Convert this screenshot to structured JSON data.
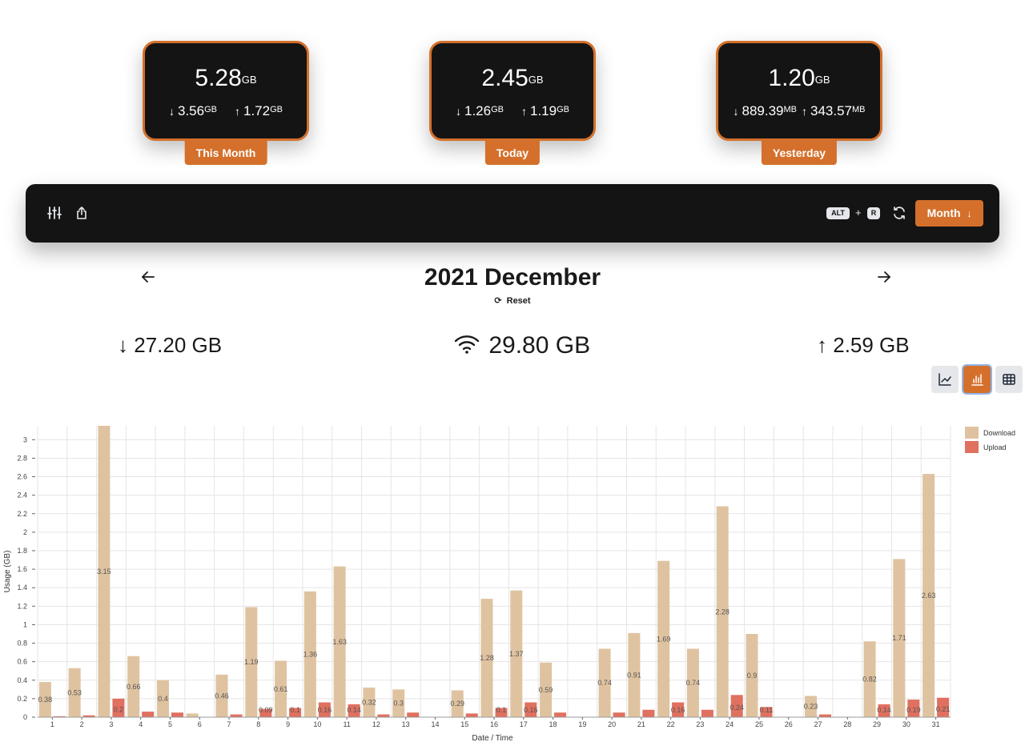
{
  "cards": [
    {
      "total": "5.28",
      "total_unit": "GB",
      "down": "3.56",
      "down_unit": "GB",
      "up": "1.72",
      "up_unit": "GB",
      "label": "This Month"
    },
    {
      "total": "2.45",
      "total_unit": "GB",
      "down": "1.26",
      "down_unit": "GB",
      "up": "1.19",
      "up_unit": "GB",
      "label": "Today"
    },
    {
      "total": "1.20",
      "total_unit": "GB",
      "down": "889.39",
      "down_unit": "MB",
      "up": "343.57",
      "up_unit": "MB",
      "label": "Yesterday"
    }
  ],
  "toolbar": {
    "filter_icon": "sliders-icon",
    "share_icon": "share-icon",
    "shortcut_key1": "ALT",
    "shortcut_plus": "+",
    "shortcut_key2": "R",
    "refresh_icon": "refresh-icon",
    "period_label": "Month"
  },
  "period": {
    "title": "2021 December",
    "reset_label": "Reset"
  },
  "totals": {
    "download": "27.20 GB",
    "total": "29.80 GB",
    "upload": "2.59 GB"
  },
  "view_modes": {
    "active": "bar",
    "options": [
      "line-chart-icon",
      "bar-chart-icon",
      "table-icon"
    ]
  },
  "colors": {
    "accent": "#d4702b",
    "download": "#dfc3a0",
    "upload": "#e0705f"
  },
  "chart_data": {
    "type": "bar",
    "xlabel": "Date / Time",
    "ylabel": "Usage (GB)",
    "ylim": [
      0,
      3.15
    ],
    "yticks": [
      0,
      0.2,
      0.4,
      0.6,
      0.8,
      1,
      1.2,
      1.4,
      1.6,
      1.8,
      2,
      2.2,
      2.4,
      2.6,
      2.8,
      3
    ],
    "legend_position": "top-right",
    "categories": [
      "1",
      "2",
      "3",
      "4",
      "5",
      "6",
      "7",
      "8",
      "9",
      "10",
      "11",
      "12",
      "13",
      "14",
      "15",
      "16",
      "17",
      "18",
      "19",
      "20",
      "21",
      "22",
      "23",
      "24",
      "25",
      "26",
      "27",
      "28",
      "29",
      "30",
      "31"
    ],
    "series": [
      {
        "name": "Download",
        "values": [
          0.38,
          0.53,
          3.15,
          0.66,
          0.4,
          0.04,
          0.46,
          1.19,
          0.61,
          1.36,
          1.63,
          0.32,
          0.3,
          0,
          0.29,
          1.28,
          1.37,
          0.59,
          0,
          0.74,
          0.91,
          1.69,
          0.74,
          2.28,
          0.9,
          0,
          0.23,
          0,
          0.82,
          1.71,
          2.63
        ],
        "labels": [
          "0.38",
          "0.53",
          "3.15",
          "0.66",
          "0.4",
          "",
          "0.46",
          "1.19",
          "0.61",
          "1.36",
          "1.63",
          "0.32",
          "0.3",
          "",
          "0.29",
          "1.28",
          "1.37",
          "0.59",
          "",
          "0.74",
          "0.91",
          "1.69",
          "0.74",
          "2.28",
          "0.9",
          "",
          "0.23",
          "",
          "0.82",
          "1.71",
          "2.63"
        ]
      },
      {
        "name": "Upload",
        "values": [
          0.01,
          0.02,
          0.2,
          0.06,
          0.05,
          0,
          0.03,
          0.09,
          0.1,
          0.16,
          0.14,
          0.03,
          0.05,
          0,
          0.04,
          0.1,
          0.16,
          0.05,
          0,
          0.05,
          0.08,
          0.16,
          0.08,
          0.24,
          0.11,
          0,
          0.03,
          0,
          0.14,
          0.19,
          0.21
        ],
        "labels": [
          "",
          "",
          "0.2",
          "",
          "",
          "",
          "",
          "0.09",
          "0.1",
          "0.16",
          "0.14",
          "",
          "",
          "",
          "",
          "0.1",
          "0.16",
          "",
          "",
          "",
          "",
          "0.16",
          "",
          "0.24",
          "0.11",
          "",
          "",
          "",
          "0.14",
          "0.19",
          "0.21"
        ]
      }
    ]
  }
}
